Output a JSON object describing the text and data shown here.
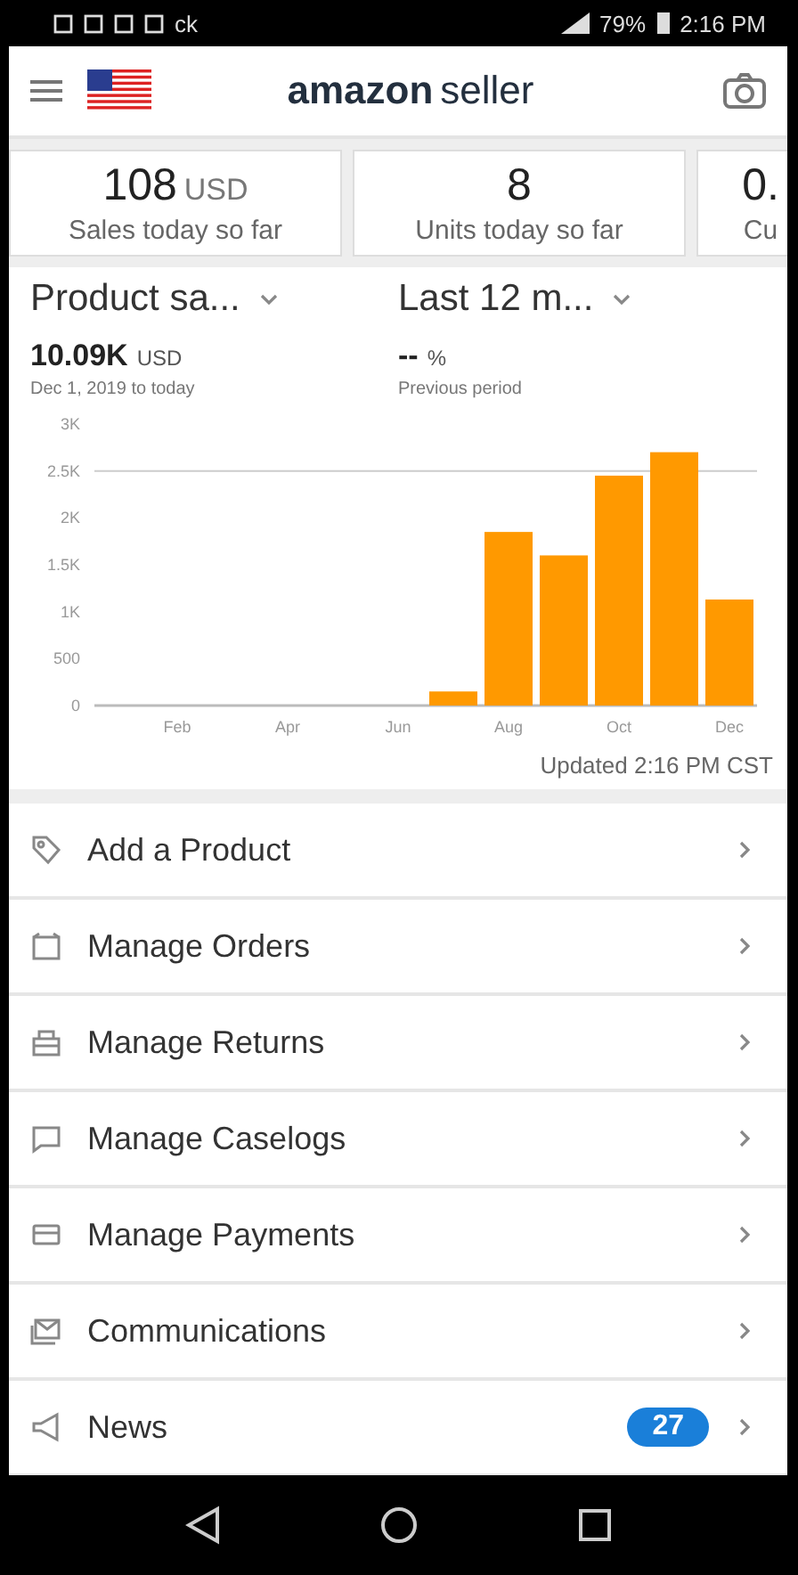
{
  "status_bar": {
    "left_text": "ck",
    "battery": "79%",
    "time": "2:16 PM"
  },
  "header": {
    "title_brand": "amazon",
    "title_rest": "seller"
  },
  "kpis": [
    {
      "value": "108",
      "unit": "USD",
      "label": "Sales today so far"
    },
    {
      "value": "8",
      "label": "Units today so far"
    },
    {
      "value": "0.",
      "label": "Cu"
    }
  ],
  "filters": [
    {
      "label": "Product sa..."
    },
    {
      "label": "Last 12 m..."
    }
  ],
  "stats": [
    {
      "value": "10.09K",
      "unit": "USD",
      "caption": "Dec 1, 2019 to today"
    },
    {
      "value": "--",
      "unit": "%",
      "caption": "Previous period"
    }
  ],
  "chart": {
    "chart_data": {
      "type": "bar",
      "categories": [
        null,
        "Feb",
        null,
        "Apr",
        null,
        "Jun",
        null,
        "Aug",
        null,
        "Oct",
        null,
        "Dec"
      ],
      "series": [
        {
          "color": "#ff9900",
          "values": [
            0,
            0,
            0,
            0,
            0,
            0,
            150,
            1850,
            1600,
            2450,
            2700,
            1130
          ]
        }
      ],
      "ylim": [
        0,
        3000
      ],
      "yticks": [
        {
          "value": 0,
          "label": "0"
        },
        {
          "value": 500,
          "label": "500"
        },
        {
          "value": 1000,
          "label": "1K"
        },
        {
          "value": 1500,
          "label": "1.5K"
        },
        {
          "value": 2000,
          "label": "2K"
        },
        {
          "value": 2500,
          "label": "2.5K"
        },
        {
          "value": 3000,
          "label": "3K"
        }
      ]
    },
    "updated": "Updated 2:16 PM CST"
  },
  "menu": [
    {
      "label": "Add a Product"
    },
    {
      "label": "Manage Orders"
    },
    {
      "label": "Manage Returns"
    },
    {
      "label": "Manage Caselogs"
    },
    {
      "label": "Manage Payments"
    },
    {
      "label": "Communications"
    },
    {
      "label": "News",
      "badge": "27"
    }
  ]
}
